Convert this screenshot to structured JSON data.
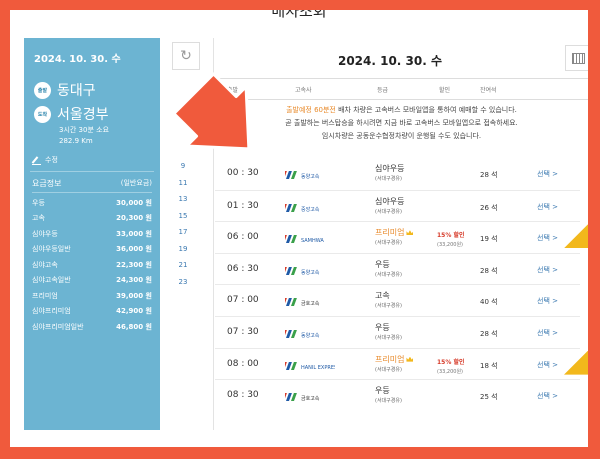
{
  "page_title": "배차조회",
  "left": {
    "date": "2024. 10. 30. 수",
    "departure_badge": "출발",
    "departure": "동대구",
    "arrival_badge": "도착",
    "arrival": "서울경부",
    "duration": "3시간 30분 소요",
    "distance": "282.9 Km",
    "edit_label": "수정",
    "fare_title": "요금정보",
    "fare_unit": "(일반요금)",
    "fares": [
      {
        "grade": "우등",
        "amount": "30,000 원"
      },
      {
        "grade": "고속",
        "amount": "20,300 원"
      },
      {
        "grade": "심야우등",
        "amount": "33,000 원"
      },
      {
        "grade": "심야우등일반",
        "amount": "36,000 원"
      },
      {
        "grade": "심야고속",
        "amount": "22,300 원"
      },
      {
        "grade": "심야고속일반",
        "amount": "24,300 원"
      },
      {
        "grade": "프리미엄",
        "amount": "39,000 원"
      },
      {
        "grade": "심야프리미엄",
        "amount": "42,900 원"
      },
      {
        "grade": "심야프리미엄일반",
        "amount": "46,800 원"
      }
    ]
  },
  "nav": {
    "dates": [
      "9",
      "11",
      "13",
      "15",
      "17",
      "19",
      "21",
      "23"
    ]
  },
  "main": {
    "date": "2024. 10. 30. 수",
    "headers": {
      "time": "출발",
      "company": "고속사",
      "grade": "등급",
      "discount": "할인",
      "seats": "잔여석"
    },
    "notice_hl": "출발예정 60분전",
    "notice_1": " 배차 차량은 고속버스 모바일앱을 통하여 예매할 수 있습니다.",
    "notice_2": "곧 출발하는 버스탑승을 하시려면 지금 바로 고속버스 모바일앱으로 접속하세요.",
    "notice_3": "임시차량은 공동운수협정차량이 운행될 수도 있습니다.",
    "rows": [
      {
        "time": "00 : 30",
        "company": "동양고속",
        "grade": "심야우등",
        "via": "(서대구경유)",
        "discount": "",
        "discount_price": "",
        "seats": "28 석",
        "select": "선택 >",
        "premium": false
      },
      {
        "time": "01 : 30",
        "company": "중앙고속",
        "grade": "심야우등",
        "via": "(서대구경유)",
        "discount": "",
        "discount_price": "",
        "seats": "26 석",
        "select": "선택 >",
        "premium": false
      },
      {
        "time": "06 : 00",
        "company": "SAMHWA",
        "grade": "프리미엄",
        "via": "(서대구경유)",
        "discount": "15% 할인",
        "discount_price": "(33,200원)",
        "seats": "19 석",
        "select": "선택 >",
        "premium": true
      },
      {
        "time": "06 : 30",
        "company": "동양고속",
        "grade": "우등",
        "via": "(서대구경유)",
        "discount": "",
        "discount_price": "",
        "seats": "28 석",
        "select": "선택 >",
        "premium": false
      },
      {
        "time": "07 : 00",
        "company": "금호고속",
        "grade": "고속",
        "via": "(서대구경유)",
        "discount": "",
        "discount_price": "",
        "seats": "40 석",
        "select": "선택 >",
        "premium": false
      },
      {
        "time": "07 : 30",
        "company": "동양고속",
        "grade": "우등",
        "via": "(서대구경유)",
        "discount": "",
        "discount_price": "",
        "seats": "28 석",
        "select": "선택 >",
        "premium": false
      },
      {
        "time": "08 : 00",
        "company": "HANIL EXPRESS",
        "grade": "프리미엄",
        "via": "(서대구경유)",
        "discount": "15% 할인",
        "discount_price": "(33,200원)",
        "seats": "18 석",
        "select": "선택 >",
        "premium": true
      },
      {
        "time": "08 : 30",
        "company": "금호고속",
        "grade": "우등",
        "via": "(서대구경유)",
        "discount": "",
        "discount_price": "",
        "seats": "25 석",
        "select": "선택 >",
        "premium": false
      }
    ]
  },
  "colors": {
    "panel": "#6cb4d2",
    "accent": "#3a78b0",
    "border": "#f05a3c",
    "premium": "#e88a2a",
    "discount": "#d63b2a"
  }
}
